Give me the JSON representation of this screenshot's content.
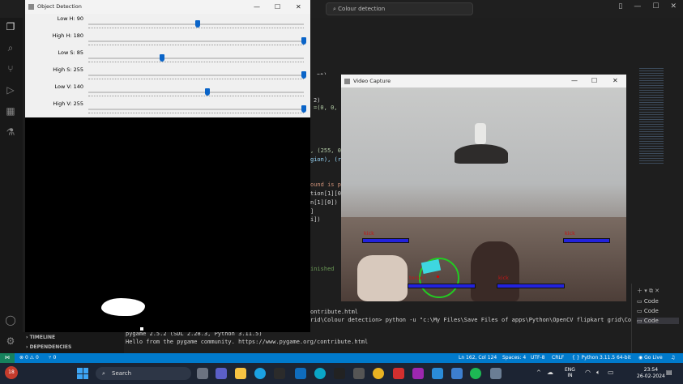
{
  "vscode": {
    "search": "Colour detection",
    "code_lines": [
      "nt)",
      "2)",
      "=(0, 0, 2",
      ", (255, 0",
      "gion), (r",
      "ound is pl",
      "tion[1][0]",
      "n[1][0])",
      "]",
      "i])",
      "inished"
    ],
    "terminal_lines": [
      "ontribute.html",
      "rid\\Colour detection> python -u \"c:\\My Files\\Save Files of apps\\Python\\OpenCV flipkart grid\\Colou",
      "pygame 2.5.2 (SDL 2.28.3, Python 3.11.5)",
      "Hello from the pygame community. https://www.pygame.org/contribute.html"
    ],
    "sidebar_sections": [
      "TIMELINE",
      "DEPENDENCIES"
    ],
    "terminal_tabs": [
      "Code",
      "Code",
      "Code"
    ],
    "status": {
      "errors": "0",
      "warnings": "0",
      "ports": "0",
      "position": "Ln 162, Col 124",
      "spaces": "Spaces: 4",
      "encoding": "UTF-8",
      "eol": "CRLF",
      "language": "Python",
      "version": "3.11.5 64-bit",
      "golive": "Go Live"
    }
  },
  "object_detection": {
    "title": "Object Detection",
    "sliders": [
      {
        "label": "Low H: 90",
        "value": 90,
        "max": 180
      },
      {
        "label": "High H: 180",
        "value": 180,
        "max": 180
      },
      {
        "label": "Low S: 85",
        "value": 85,
        "max": 255
      },
      {
        "label": "High S: 255",
        "value": 255,
        "max": 255
      },
      {
        "label": "Low V: 140",
        "value": 140,
        "max": 255
      },
      {
        "label": "High V: 255",
        "value": 255,
        "max": 255
      }
    ]
  },
  "video": {
    "title": "Video Capture",
    "zones": [
      "kick",
      "kick",
      "kick"
    ],
    "player_label": "torso I"
  },
  "taskbar": {
    "search": "Search",
    "lang_top": "ENG",
    "lang_bottom": "IN",
    "time": "23:54",
    "date": "26-02-2024",
    "weather_badge": "18"
  },
  "colors": {
    "accent": "#007acc",
    "zone_bar": "#2222dd",
    "circle": "#22cc22",
    "label": "#c01818"
  }
}
